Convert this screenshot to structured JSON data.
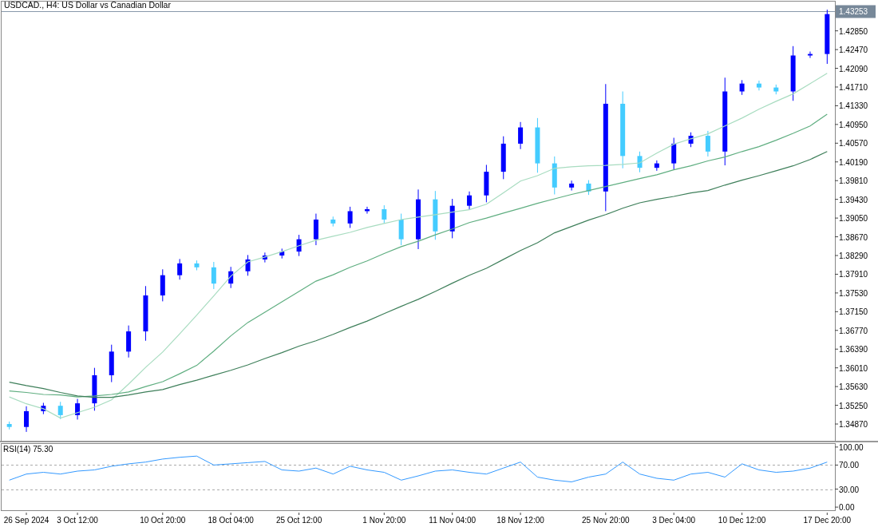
{
  "title": "USDCAD., H4:  US Dollar vs Canadian Dollar",
  "price_chart": {
    "chart_data": {
      "type": "candlestick",
      "ylim": [
        1.3453,
        1.4346
      ],
      "categories": [
        null,
        "26 Sep 2024",
        null,
        null,
        "3 Oct 12:00",
        null,
        null,
        null,
        null,
        "10 Oct 20:00",
        null,
        null,
        null,
        "18 Oct 04:00",
        null,
        null,
        null,
        "25 Oct 12:00",
        null,
        null,
        null,
        null,
        "1 Nov 20:00",
        null,
        null,
        null,
        "11 Nov 04:00",
        null,
        null,
        null,
        "18 Nov 12:00",
        null,
        null,
        null,
        null,
        "25 Nov 20:00",
        null,
        null,
        null,
        "3 Dec 04:00",
        null,
        null,
        null,
        "10 Dec 12:00",
        null,
        null,
        null,
        null,
        "17 Dec 20:00"
      ],
      "yticks": [
        {
          "value": 1.4285,
          "label": "1.42850"
        },
        {
          "value": 1.4247,
          "label": "1.42470"
        },
        {
          "value": 1.4209,
          "label": "1.42090"
        },
        {
          "value": 1.4171,
          "label": "1.41710"
        },
        {
          "value": 1.4133,
          "label": "1.41330"
        },
        {
          "value": 1.4095,
          "label": "1.40950"
        },
        {
          "value": 1.4057,
          "label": "1.40570"
        },
        {
          "value": 1.4019,
          "label": "1.40190"
        },
        {
          "value": 1.3981,
          "label": "1.39810"
        },
        {
          "value": 1.3943,
          "label": "1.39430"
        },
        {
          "value": 1.3905,
          "label": "1.39050"
        },
        {
          "value": 1.3867,
          "label": "1.38670"
        },
        {
          "value": 1.3829,
          "label": "1.38290"
        },
        {
          "value": 1.3791,
          "label": "1.37910"
        },
        {
          "value": 1.3753,
          "label": "1.37530"
        },
        {
          "value": 1.3715,
          "label": "1.37150"
        },
        {
          "value": 1.3677,
          "label": "1.36770"
        },
        {
          "value": 1.3639,
          "label": "1.36390"
        },
        {
          "value": 1.3601,
          "label": "1.36010"
        },
        {
          "value": 1.3563,
          "label": "1.35630"
        },
        {
          "value": 1.3525,
          "label": "1.35250"
        },
        {
          "value": 1.3487,
          "label": "1.34870"
        }
      ],
      "ohlc": [
        [
          1.3487,
          1.3492,
          1.3476,
          1.3481
        ],
        [
          1.3481,
          1.3523,
          1.3471,
          1.3513
        ],
        [
          1.3513,
          1.353,
          1.3507,
          1.3524
        ],
        [
          1.3524,
          1.3532,
          1.3497,
          1.3505
        ],
        [
          1.3505,
          1.3538,
          1.3496,
          1.3529
        ],
        [
          1.3529,
          1.3601,
          1.3514,
          1.3586
        ],
        [
          1.3586,
          1.3648,
          1.3572,
          1.3634
        ],
        [
          1.3634,
          1.3687,
          1.3622,
          1.3675
        ],
        [
          1.3675,
          1.3767,
          1.3656,
          1.3748
        ],
        [
          1.3748,
          1.3801,
          1.3736,
          1.3789
        ],
        [
          1.3789,
          1.3822,
          1.378,
          1.3813
        ],
        [
          1.3813,
          1.3819,
          1.3799,
          1.3805
        ],
        [
          1.3805,
          1.3816,
          1.3761,
          1.3772
        ],
        [
          1.3772,
          1.3806,
          1.3763,
          1.3797
        ],
        [
          1.3797,
          1.383,
          1.3788,
          1.3821
        ],
        [
          1.3821,
          1.3835,
          1.3815,
          1.3829
        ],
        [
          1.3829,
          1.3843,
          1.3823,
          1.3837
        ],
        [
          1.3837,
          1.3871,
          1.3828,
          1.3862
        ],
        [
          1.3862,
          1.3914,
          1.385,
          1.3902
        ],
        [
          1.3902,
          1.3908,
          1.3888,
          1.3894
        ],
        [
          1.3894,
          1.3928,
          1.3885,
          1.3919
        ],
        [
          1.3919,
          1.3928,
          1.3914,
          1.3923
        ],
        [
          1.3923,
          1.3931,
          1.3894,
          1.3902
        ],
        [
          1.3902,
          1.3914,
          1.385,
          1.3862
        ],
        [
          1.3862,
          1.3963,
          1.3842,
          1.3943
        ],
        [
          1.3943,
          1.396,
          1.3861,
          1.3878
        ],
        [
          1.3878,
          1.3944,
          1.3864,
          1.393
        ],
        [
          1.393,
          1.3959,
          1.3922,
          1.3951
        ],
        [
          1.3951,
          1.4013,
          1.3937,
          1.3999
        ],
        [
          1.3999,
          1.4071,
          1.3984,
          1.4056
        ],
        [
          1.4056,
          1.41,
          1.4045,
          1.4089
        ],
        [
          1.4089,
          1.4108,
          1.3997,
          1.4016
        ],
        [
          1.4016,
          1.403,
          1.3953,
          1.3967
        ],
        [
          1.3967,
          1.3981,
          1.3961,
          1.3975
        ],
        [
          1.3975,
          1.3982,
          1.3952,
          1.3959
        ],
        [
          1.3959,
          1.4177,
          1.3919,
          1.4137
        ],
        [
          1.4137,
          1.4162,
          1.4006,
          1.4031
        ],
        [
          1.4031,
          1.404,
          1.3998,
          1.4007
        ],
        [
          1.4007,
          1.4022,
          1.4001,
          1.4016
        ],
        [
          1.4016,
          1.4068,
          1.4004,
          1.4056
        ],
        [
          1.4056,
          1.4079,
          1.4049,
          1.4072
        ],
        [
          1.4072,
          1.4082,
          1.403,
          1.404
        ],
        [
          1.404,
          1.419,
          1.4012,
          1.4162
        ],
        [
          1.4162,
          1.4185,
          1.4155,
          1.4178
        ],
        [
          1.4178,
          1.4184,
          1.4164,
          1.417
        ],
        [
          1.417,
          1.4176,
          1.4156,
          1.4162
        ],
        [
          1.4162,
          1.4254,
          1.4143,
          1.4235
        ],
        [
          1.4235,
          1.4243,
          1.423,
          1.4238
        ],
        [
          1.4238,
          1.4328,
          1.4218,
          1.4319
        ]
      ],
      "series": [
        {
          "type": "line",
          "color": "#a8dcc0",
          "values": [
            1.3542,
            1.3528,
            1.3518,
            1.3499,
            1.351,
            1.3521,
            1.3536,
            1.3568,
            1.3602,
            1.3633,
            1.367,
            1.3708,
            1.3747,
            1.3787,
            1.3816,
            1.3826,
            1.3837,
            1.3849,
            1.386,
            1.3868,
            1.3876,
            1.3886,
            1.3894,
            1.3902,
            1.3907,
            1.3912,
            1.3917,
            1.3922,
            1.3933,
            1.3956,
            1.398,
            1.3991,
            1.4006,
            1.4009,
            1.4011,
            1.4012,
            1.4014,
            1.4017,
            1.4037,
            1.4055,
            1.4066,
            1.4076,
            1.4092,
            1.4108,
            1.4126,
            1.4142,
            1.4157,
            1.4178,
            1.4199
          ]
        },
        {
          "type": "line",
          "color": "#5fae80",
          "values": [
            1.3554,
            1.3551,
            1.3547,
            1.3546,
            1.3542,
            1.3544,
            1.3547,
            1.3552,
            1.3563,
            1.3573,
            1.3589,
            1.3606,
            1.3635,
            1.3666,
            1.3693,
            1.3714,
            1.3735,
            1.3756,
            1.3777,
            1.379,
            1.3805,
            1.3818,
            1.3833,
            1.3847,
            1.3858,
            1.3871,
            1.3883,
            1.3896,
            1.3905,
            1.3915,
            1.3925,
            1.3935,
            1.3944,
            1.3953,
            1.3961,
            1.3969,
            1.3977,
            1.3985,
            1.3993,
            1.4003,
            1.4011,
            1.4021,
            1.4029,
            1.404,
            1.405,
            1.4063,
            1.4077,
            1.4092,
            1.4116
          ]
        },
        {
          "type": "line",
          "color": "#3e7f5a",
          "values": [
            1.3572,
            1.3565,
            1.3559,
            1.3551,
            1.3544,
            1.3541,
            1.3541,
            1.3546,
            1.3552,
            1.3557,
            1.3567,
            1.3576,
            1.3586,
            1.3596,
            1.3607,
            1.362,
            1.3632,
            1.3645,
            1.3656,
            1.3669,
            1.3683,
            1.3696,
            1.3711,
            1.3726,
            1.374,
            1.3756,
            1.3773,
            1.3789,
            1.3803,
            1.3821,
            1.3839,
            1.3855,
            1.3875,
            1.3888,
            1.3901,
            1.3912,
            1.3925,
            1.3936,
            1.3943,
            1.3949,
            1.3956,
            1.3961,
            1.3972,
            1.3982,
            1.3991,
            1.4001,
            1.4011,
            1.4024,
            1.404
          ]
        }
      ],
      "ref_lines": [
        {
          "axis": "y",
          "value": 1.43253,
          "label": "1.43253"
        }
      ]
    }
  },
  "rsi_panel": {
    "label": "RSI(14) 75.30",
    "chart_data": {
      "type": "line",
      "ylim": [
        -6.5,
        107.8
      ],
      "yticks": [
        {
          "value": 100,
          "label": "100.00"
        },
        {
          "value": 70,
          "label": "70.00"
        },
        {
          "value": 30,
          "label": "30.00"
        },
        {
          "value": 0,
          "label": "0.00"
        }
      ],
      "series": [
        {
          "color": "#3399ff",
          "values": [
            45,
            55,
            58,
            55,
            60,
            62,
            68,
            72,
            75,
            80,
            83,
            85,
            70,
            72,
            74,
            76,
            62,
            60,
            65,
            55,
            68,
            62,
            58,
            45,
            52,
            60,
            62,
            58,
            55,
            65,
            75,
            50,
            45,
            42,
            50,
            55,
            75,
            55,
            48,
            45,
            55,
            58,
            50,
            72,
            62,
            58,
            60,
            65,
            75
          ]
        }
      ]
    }
  }
}
